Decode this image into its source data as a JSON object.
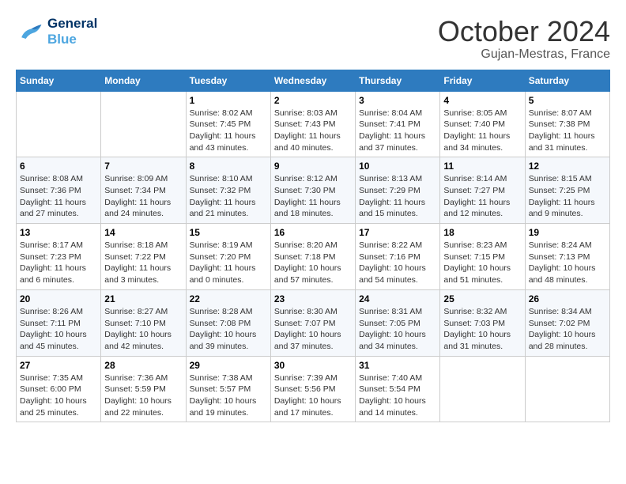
{
  "header": {
    "logo_line1": "General",
    "logo_line2": "Blue",
    "month": "October 2024",
    "location": "Gujan-Mestras, France"
  },
  "columns": [
    "Sunday",
    "Monday",
    "Tuesday",
    "Wednesday",
    "Thursday",
    "Friday",
    "Saturday"
  ],
  "rows": [
    [
      {
        "day": "",
        "sunrise": "",
        "sunset": "",
        "daylight": ""
      },
      {
        "day": "",
        "sunrise": "",
        "sunset": "",
        "daylight": ""
      },
      {
        "day": "1",
        "sunrise": "Sunrise: 8:02 AM",
        "sunset": "Sunset: 7:45 PM",
        "daylight": "Daylight: 11 hours and 43 minutes."
      },
      {
        "day": "2",
        "sunrise": "Sunrise: 8:03 AM",
        "sunset": "Sunset: 7:43 PM",
        "daylight": "Daylight: 11 hours and 40 minutes."
      },
      {
        "day": "3",
        "sunrise": "Sunrise: 8:04 AM",
        "sunset": "Sunset: 7:41 PM",
        "daylight": "Daylight: 11 hours and 37 minutes."
      },
      {
        "day": "4",
        "sunrise": "Sunrise: 8:05 AM",
        "sunset": "Sunset: 7:40 PM",
        "daylight": "Daylight: 11 hours and 34 minutes."
      },
      {
        "day": "5",
        "sunrise": "Sunrise: 8:07 AM",
        "sunset": "Sunset: 7:38 PM",
        "daylight": "Daylight: 11 hours and 31 minutes."
      }
    ],
    [
      {
        "day": "6",
        "sunrise": "Sunrise: 8:08 AM",
        "sunset": "Sunset: 7:36 PM",
        "daylight": "Daylight: 11 hours and 27 minutes."
      },
      {
        "day": "7",
        "sunrise": "Sunrise: 8:09 AM",
        "sunset": "Sunset: 7:34 PM",
        "daylight": "Daylight: 11 hours and 24 minutes."
      },
      {
        "day": "8",
        "sunrise": "Sunrise: 8:10 AM",
        "sunset": "Sunset: 7:32 PM",
        "daylight": "Daylight: 11 hours and 21 minutes."
      },
      {
        "day": "9",
        "sunrise": "Sunrise: 8:12 AM",
        "sunset": "Sunset: 7:30 PM",
        "daylight": "Daylight: 11 hours and 18 minutes."
      },
      {
        "day": "10",
        "sunrise": "Sunrise: 8:13 AM",
        "sunset": "Sunset: 7:29 PM",
        "daylight": "Daylight: 11 hours and 15 minutes."
      },
      {
        "day": "11",
        "sunrise": "Sunrise: 8:14 AM",
        "sunset": "Sunset: 7:27 PM",
        "daylight": "Daylight: 11 hours and 12 minutes."
      },
      {
        "day": "12",
        "sunrise": "Sunrise: 8:15 AM",
        "sunset": "Sunset: 7:25 PM",
        "daylight": "Daylight: 11 hours and 9 minutes."
      }
    ],
    [
      {
        "day": "13",
        "sunrise": "Sunrise: 8:17 AM",
        "sunset": "Sunset: 7:23 PM",
        "daylight": "Daylight: 11 hours and 6 minutes."
      },
      {
        "day": "14",
        "sunrise": "Sunrise: 8:18 AM",
        "sunset": "Sunset: 7:22 PM",
        "daylight": "Daylight: 11 hours and 3 minutes."
      },
      {
        "day": "15",
        "sunrise": "Sunrise: 8:19 AM",
        "sunset": "Sunset: 7:20 PM",
        "daylight": "Daylight: 11 hours and 0 minutes."
      },
      {
        "day": "16",
        "sunrise": "Sunrise: 8:20 AM",
        "sunset": "Sunset: 7:18 PM",
        "daylight": "Daylight: 10 hours and 57 minutes."
      },
      {
        "day": "17",
        "sunrise": "Sunrise: 8:22 AM",
        "sunset": "Sunset: 7:16 PM",
        "daylight": "Daylight: 10 hours and 54 minutes."
      },
      {
        "day": "18",
        "sunrise": "Sunrise: 8:23 AM",
        "sunset": "Sunset: 7:15 PM",
        "daylight": "Daylight: 10 hours and 51 minutes."
      },
      {
        "day": "19",
        "sunrise": "Sunrise: 8:24 AM",
        "sunset": "Sunset: 7:13 PM",
        "daylight": "Daylight: 10 hours and 48 minutes."
      }
    ],
    [
      {
        "day": "20",
        "sunrise": "Sunrise: 8:26 AM",
        "sunset": "Sunset: 7:11 PM",
        "daylight": "Daylight: 10 hours and 45 minutes."
      },
      {
        "day": "21",
        "sunrise": "Sunrise: 8:27 AM",
        "sunset": "Sunset: 7:10 PM",
        "daylight": "Daylight: 10 hours and 42 minutes."
      },
      {
        "day": "22",
        "sunrise": "Sunrise: 8:28 AM",
        "sunset": "Sunset: 7:08 PM",
        "daylight": "Daylight: 10 hours and 39 minutes."
      },
      {
        "day": "23",
        "sunrise": "Sunrise: 8:30 AM",
        "sunset": "Sunset: 7:07 PM",
        "daylight": "Daylight: 10 hours and 37 minutes."
      },
      {
        "day": "24",
        "sunrise": "Sunrise: 8:31 AM",
        "sunset": "Sunset: 7:05 PM",
        "daylight": "Daylight: 10 hours and 34 minutes."
      },
      {
        "day": "25",
        "sunrise": "Sunrise: 8:32 AM",
        "sunset": "Sunset: 7:03 PM",
        "daylight": "Daylight: 10 hours and 31 minutes."
      },
      {
        "day": "26",
        "sunrise": "Sunrise: 8:34 AM",
        "sunset": "Sunset: 7:02 PM",
        "daylight": "Daylight: 10 hours and 28 minutes."
      }
    ],
    [
      {
        "day": "27",
        "sunrise": "Sunrise: 7:35 AM",
        "sunset": "Sunset: 6:00 PM",
        "daylight": "Daylight: 10 hours and 25 minutes."
      },
      {
        "day": "28",
        "sunrise": "Sunrise: 7:36 AM",
        "sunset": "Sunset: 5:59 PM",
        "daylight": "Daylight: 10 hours and 22 minutes."
      },
      {
        "day": "29",
        "sunrise": "Sunrise: 7:38 AM",
        "sunset": "Sunset: 5:57 PM",
        "daylight": "Daylight: 10 hours and 19 minutes."
      },
      {
        "day": "30",
        "sunrise": "Sunrise: 7:39 AM",
        "sunset": "Sunset: 5:56 PM",
        "daylight": "Daylight: 10 hours and 17 minutes."
      },
      {
        "day": "31",
        "sunrise": "Sunrise: 7:40 AM",
        "sunset": "Sunset: 5:54 PM",
        "daylight": "Daylight: 10 hours and 14 minutes."
      },
      {
        "day": "",
        "sunrise": "",
        "sunset": "",
        "daylight": ""
      },
      {
        "day": "",
        "sunrise": "",
        "sunset": "",
        "daylight": ""
      }
    ]
  ]
}
